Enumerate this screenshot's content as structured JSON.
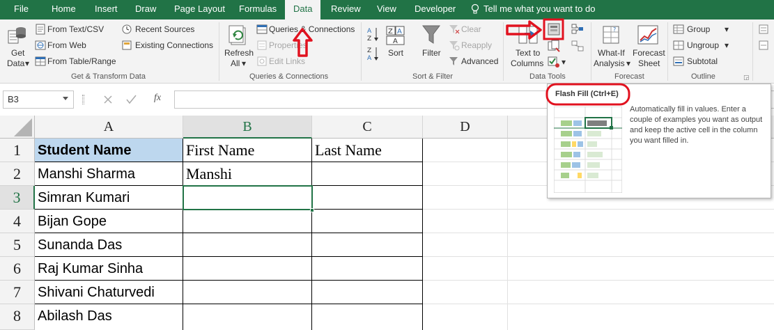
{
  "tabs": [
    {
      "label": "File"
    },
    {
      "label": "Home"
    },
    {
      "label": "Insert"
    },
    {
      "label": "Draw"
    },
    {
      "label": "Page Layout"
    },
    {
      "label": "Formulas"
    },
    {
      "label": "Data",
      "active": true
    },
    {
      "label": "Review"
    },
    {
      "label": "View"
    },
    {
      "label": "Developer"
    }
  ],
  "tell_me": "Tell me what you want to do",
  "ribbon": {
    "get_transform": {
      "get_data": [
        "Get",
        "Data"
      ],
      "from_text_csv": "From Text/CSV",
      "from_web": "From Web",
      "from_table_range": "From Table/Range",
      "recent_sources": "Recent Sources",
      "existing_connections": "Existing Connections",
      "group_label": "Get & Transform Data"
    },
    "queries": {
      "refresh_all": [
        "Refresh",
        "All"
      ],
      "queries_connections": "Queries & Connections",
      "properties": "Properties",
      "edit_links": "Edit Links",
      "group_label": "Queries & Connections"
    },
    "sort_filter": {
      "sort": "Sort",
      "filter": "Filter",
      "clear": "Clear",
      "reapply": "Reapply",
      "advanced": "Advanced",
      "group_label": "Sort & Filter"
    },
    "data_tools": {
      "text_to_columns": [
        "Text to",
        "Columns"
      ],
      "group_label": "Data Tools"
    },
    "forecast": {
      "what_if": [
        "What-If",
        "Analysis"
      ],
      "forecast_sheet": [
        "Forecast",
        "Sheet"
      ],
      "group_label": "Forecast"
    },
    "outline": {
      "group": "Group",
      "ungroup": "Ungroup",
      "subtotal": "Subtotal",
      "group_label": "Outline"
    }
  },
  "formula_bar": {
    "name_box": "B3",
    "fx": "fx",
    "content": ""
  },
  "sheet": {
    "columns": [
      "A",
      "B",
      "C",
      "D"
    ],
    "rows": [
      "1",
      "2",
      "3",
      "4",
      "5",
      "6",
      "7",
      "8"
    ],
    "cells_a": [
      "Student Name",
      "Manshi Sharma",
      "Simran Kumari",
      "Bijan Gope",
      "Sunanda Das",
      "Raj Kumar Sinha",
      "Shivani Chaturvedi",
      "Abilash Das"
    ],
    "cells_b": [
      "First Name",
      "Manshi",
      "",
      "",
      "",
      "",
      "",
      ""
    ],
    "cells_c": [
      "Last Name",
      "",
      "",
      "",
      "",
      "",
      "",
      ""
    ],
    "selected_cell": "B3",
    "header_fill": "#bdd7ee"
  },
  "tooltip": {
    "title": "Flash Fill (Ctrl+E)",
    "description": "Automatically fill in values. Enter a couple of examples you want as output and keep the active cell in the column you want filled in."
  },
  "colors": {
    "brand": "#217346",
    "annotation": "#e1121f"
  }
}
